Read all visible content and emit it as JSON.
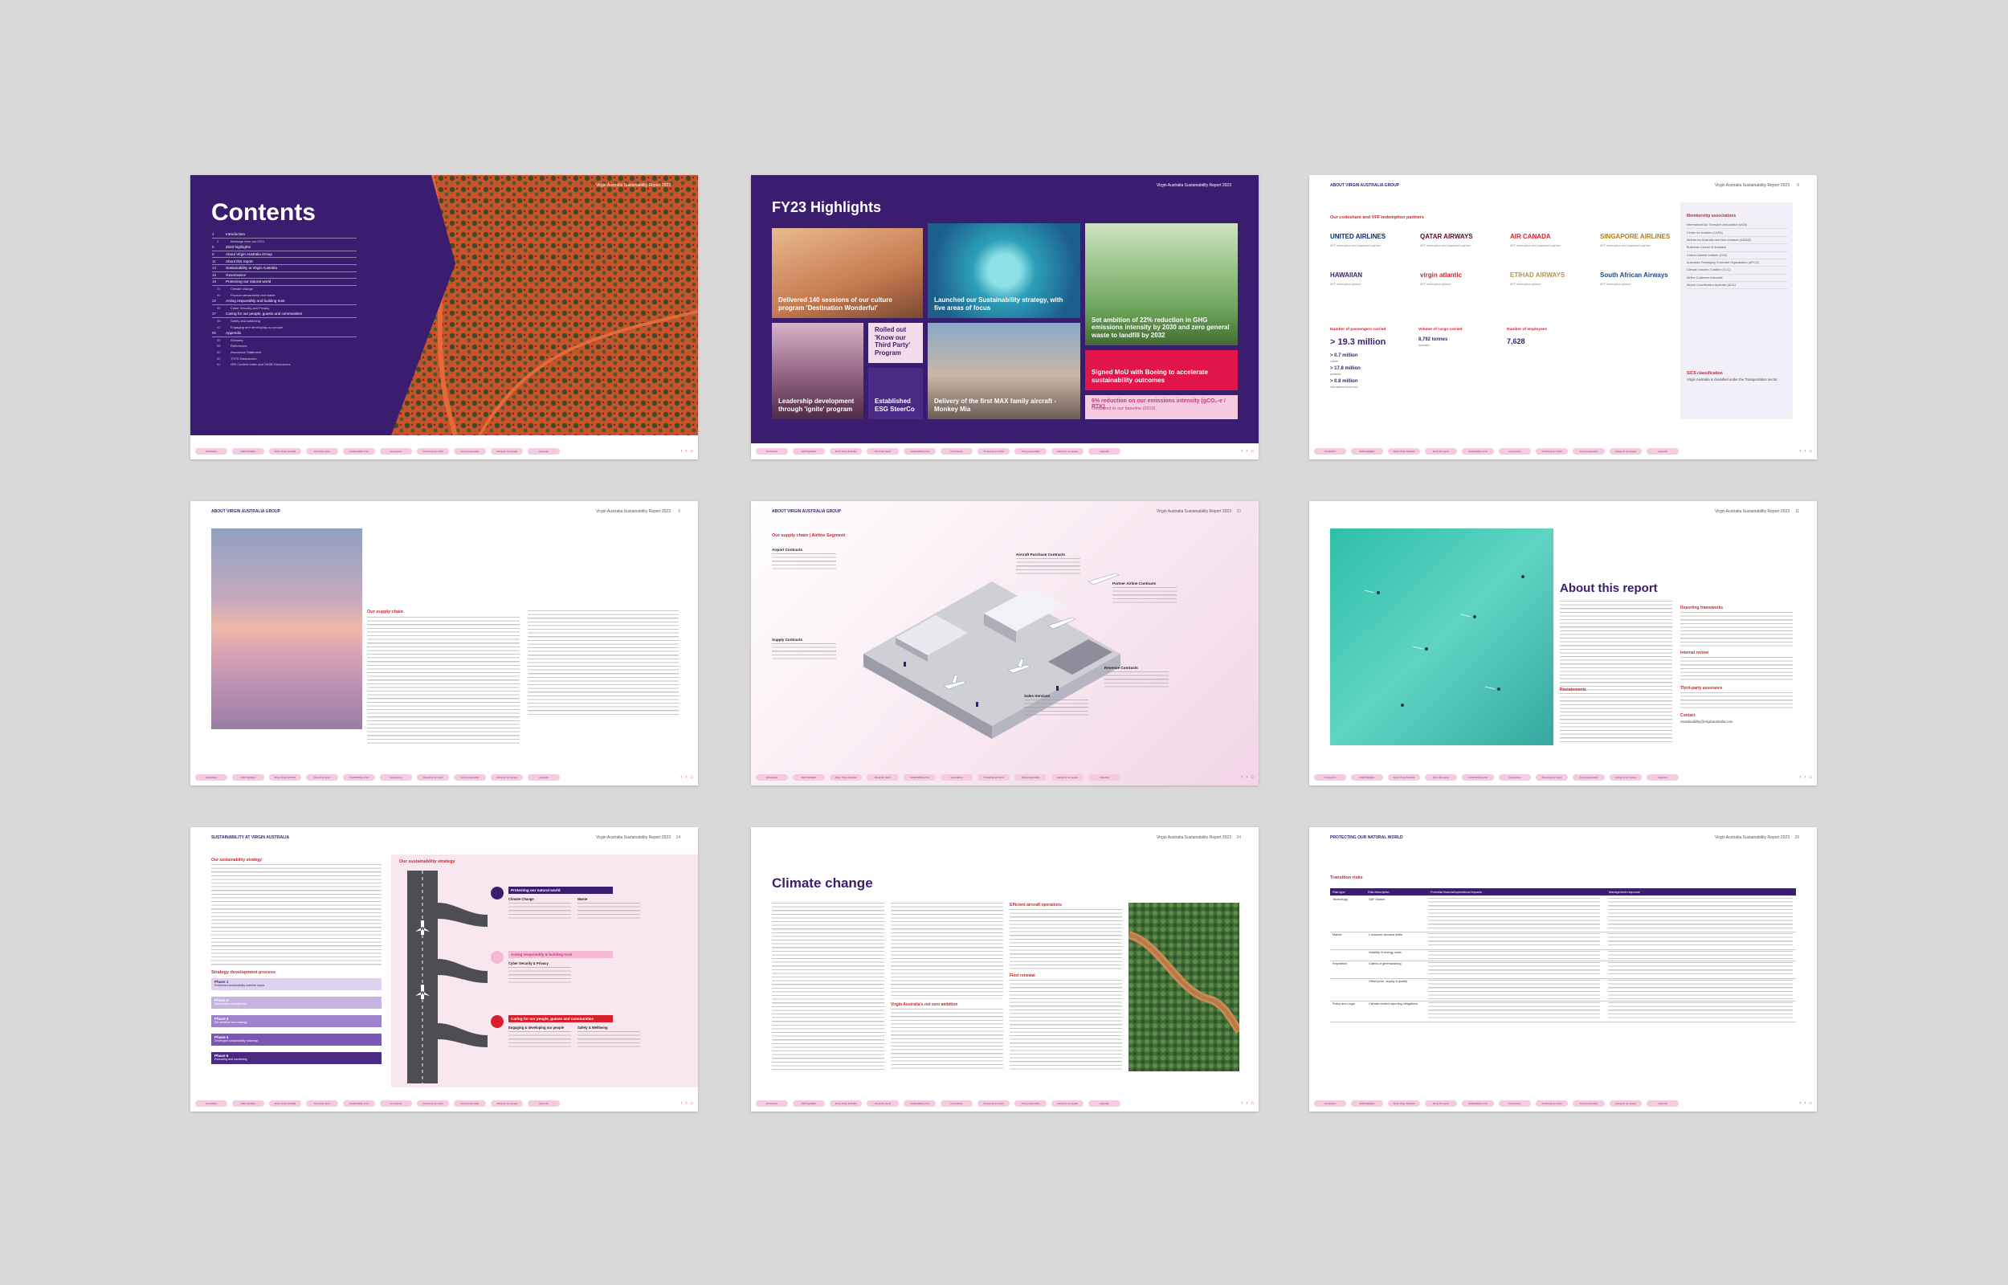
{
  "footer_tabs": [
    "Introduction",
    "2023 highlights",
    "About Virgin Australia",
    "About this report",
    "Sustainability at VA",
    "Governance",
    "Protecting our world",
    "Acting responsibly",
    "Caring for our people",
    "Appendix"
  ],
  "footer_nav": {
    "prev": "‹",
    "next": "›",
    "home": "⌂"
  },
  "contents": {
    "title": "Contents",
    "header_right": "Virgin Australia Sustainability Report 2023",
    "items": [
      {
        "num": "4",
        "label": "Introduction",
        "level": "main"
      },
      {
        "num": "5",
        "label": "Message from our CEO",
        "level": "sub"
      },
      {
        "num": "6",
        "label": "2023 highlights",
        "level": "main"
      },
      {
        "num": "8",
        "label": "About Virgin Australia Group",
        "level": "main"
      },
      {
        "num": "11",
        "label": "About this report",
        "level": "main"
      },
      {
        "num": "13",
        "label": "Sustainability at Virgin Australia",
        "level": "main"
      },
      {
        "num": "16",
        "label": "Governance",
        "level": "main"
      },
      {
        "num": "19",
        "label": "Protecting our natural world",
        "level": "main"
      },
      {
        "num": "24",
        "label": "Climate change",
        "level": "sub"
      },
      {
        "num": "30",
        "label": "Product stewardship and waste",
        "level": "sub"
      },
      {
        "num": "32",
        "label": "Acting responsibly and building trust",
        "level": "main"
      },
      {
        "num": "35",
        "label": "Cyber Security and Privacy",
        "level": "sub"
      },
      {
        "num": "37",
        "label": "Caring for our people, guests and communities",
        "level": "main"
      },
      {
        "num": "38",
        "label": "Safety and wellbeing",
        "level": "sub"
      },
      {
        "num": "42",
        "label": "Engaging and developing our people",
        "level": "sub"
      },
      {
        "num": "55",
        "label": "Appendix",
        "level": "main"
      },
      {
        "num": "56",
        "label": "Glossary",
        "level": "sub"
      },
      {
        "num": "58",
        "label": "References",
        "level": "sub"
      },
      {
        "num": "59",
        "label": "Assurance Statement",
        "level": "sub"
      },
      {
        "num": "60",
        "label": "TCFD Disclosures",
        "level": "sub"
      },
      {
        "num": "61",
        "label": "GRI Content Index and SASB Disclosures",
        "level": "sub"
      }
    ]
  },
  "highlights": {
    "title": "FY23 Highlights",
    "header_right": "Virgin Australia Sustainability Report 2023",
    "tiles": [
      "Delivered 140 sessions of our culture program 'Destination Wonderful'",
      "Launched our Sustainability strategy, with five areas of focus",
      "Set ambition of 22% reduction in GHG emissions intensity by 2030 and zero general waste to landfill by 2032",
      "Leadership development through 'ignite' program",
      "Rolled out 'Know our Third Party' Program",
      "Established ESG SteerCo",
      "Delivery of the first MAX family aircraft - Monkey Mia",
      "Signed MoU with Boeing to accelerate sustainability outcomes",
      "6% reduction on our emissions intensity (gCO₂-e / RTK)",
      "compared to our baseline (2019)"
    ]
  },
  "partners": {
    "header_left": "ABOUT VIRGIN AUSTRALIA GROUP",
    "header_right": "Virgin Australia Sustainability Report 2023",
    "page_num": "9",
    "heading": "Our codeshare and VFF redemption partners",
    "logos": [
      "UNITED AIRLINES",
      "QATAR AIRWAYS",
      "AIR CANADA",
      "SINGAPORE AIRLINES",
      "HAWAIIAN",
      "virgin atlantic",
      "ETIHAD AIRWAYS",
      "South African Airways"
    ],
    "logo_captions": [
      "VFF redemption and codeshare partner",
      "VFF redemption and codeshare partner",
      "VFF redemption and codeshare partner",
      "VFF redemption and codeshare partner",
      "VFF redemption partner",
      "VFF redemption partner",
      "VFF redemption partner",
      "VFF redemption partner"
    ],
    "stats": {
      "passengers_label": "Number of passengers carried",
      "passengers": "> 19.3 million",
      "charter": "> 0.7 million",
      "charter_cap": "charter",
      "domestic": "> 17.8 million",
      "domestic_cap": "domestic",
      "intl": "> 0.8 million",
      "intl_cap": "international short-haul",
      "cargo_label": "Volume of cargo carried",
      "cargo": "8,792 tonnes",
      "cargo_cap": "domestic",
      "employees_label": "Number of employees",
      "employees": "7,628"
    },
    "memberships_title": "Membership associations",
    "memberships": [
      "International Air Transport Association (IATA)",
      "Centre for Aviation (CAPA)",
      "Airlines for Australia and New Zealand (A4ANZ)",
      "Business Council of Australia",
      "Carbon Market Institute (CMI)",
      "Australian Packaging Covenant Organisation (APCO)",
      "Climate Leaders Coalition (CLC)",
      "Airline Customer Advocate",
      "Airport Coordination Australia (ACA)"
    ],
    "sics_title": "SICS classification",
    "sics_text": "Virgin Australia is classified under the Transportation sector."
  },
  "supply": {
    "header_left": "ABOUT VIRGIN AUSTRALIA GROUP",
    "header_right": "Virgin Australia Sustainability Report 2023",
    "page_num": "9",
    "heading": "Our supply chain"
  },
  "airline": {
    "header_left": "ABOUT VIRGIN AUSTRALIA GROUP",
    "header_right": "Virgin Australia Sustainability Report 2023",
    "page_num": "10",
    "heading": "Our supply chain | Airline Segment",
    "labels": [
      "Airport Contracts",
      "Aircraft Purchase Contracts",
      "Partner Airline Contracts",
      "Supply Contracts",
      "Revenue Contracts",
      "Sales Services"
    ]
  },
  "about_report": {
    "header_right": "Virgin Australia Sustainability Report 2023",
    "page_num": "11",
    "title": "About this report",
    "subheads": [
      "Reporting frameworks",
      "Internal review",
      "Restatements",
      "Third-party assurance",
      "Contact"
    ],
    "contact_email": "Sustainability@virginaustralia.com"
  },
  "strategy": {
    "header_left": "SUSTAINABILITY AT VIRGIN AUSTRALIA",
    "header_right": "Virgin Australia Sustainability Report 2023",
    "page_num": "14",
    "intro_head": "Our sustainability strategy",
    "panel_title": "Our sustainability strategy",
    "process_head": "Strategy development process",
    "phases": [
      "Phase 1",
      "Phase 2",
      "Phase 3",
      "Phase 4",
      "Phase 5"
    ],
    "phase_captions": [
      "Refreshed sustainability material topics",
      "Stakeholder engagement",
      "Set ambition and strategy",
      "Developed sustainability roadmap",
      "Executing and monitoring"
    ],
    "pillars": [
      "Protecting our natural world",
      "Acting responsibly & building trust",
      "Caring for our people, guests and communities"
    ],
    "pillar_items": [
      [
        "Climate Change",
        "Waste"
      ],
      [
        "Cyber Security & Privacy"
      ],
      [
        "Engaging & developing our people",
        "Safety & Wellbeing"
      ]
    ]
  },
  "climate": {
    "header_right": "Virgin Australia Sustainability Report 2023",
    "page_num": "24",
    "title": "Climate change",
    "subheads": [
      "Efficient aircraft operations",
      "Fleet renewal",
      "Virgin Australia's net zero ambition"
    ]
  },
  "risks": {
    "header_left": "PROTECTING OUR NATURAL WORLD",
    "header_right": "Virgin Australia Sustainability Report 2023",
    "page_num": "29",
    "heading": "Transition risks",
    "columns": [
      "Risk type",
      "Risk description",
      "Potential financial/operational impacts",
      "Management response"
    ],
    "rows": [
      {
        "type": "Technology",
        "desc": "SAF Market"
      },
      {
        "type": "Market",
        "desc": "Consumer demand shifts"
      },
      {
        "type": "",
        "desc": "Volatility of energy costs"
      },
      {
        "type": "Reputation",
        "desc": "Claims of greenwashing"
      },
      {
        "type": "",
        "desc": "Offset price, supply & quality"
      },
      {
        "type": "Policy and Legal",
        "desc": "Climate-related reporting obligations"
      }
    ]
  }
}
